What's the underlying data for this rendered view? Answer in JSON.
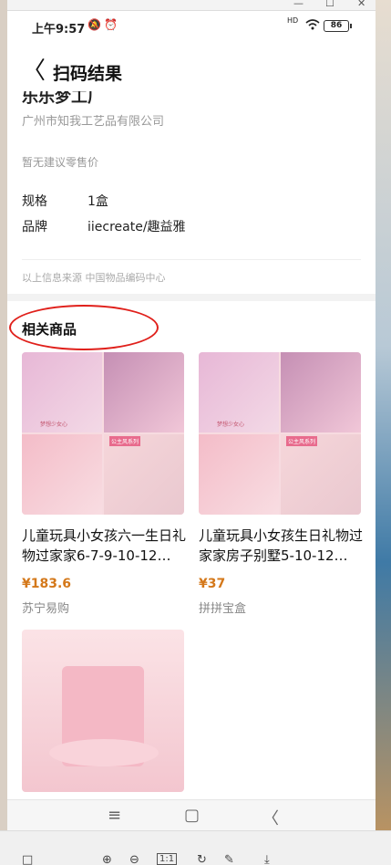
{
  "window": {
    "minimize": "—",
    "maximize": "☐",
    "close": "✕"
  },
  "status_bar": {
    "time": "上午9:57",
    "mute_icon": "🔕",
    "alarm_icon": "⏰",
    "signal": "HD",
    "wifi": "wifi",
    "battery": "86"
  },
  "header": {
    "back": "〈",
    "title": "扫码结果"
  },
  "product": {
    "name_cut": "乐乐梦工厂",
    "company": "广州市知我工艺品有限公司",
    "price_note": "暂无建议零售价",
    "specs": [
      {
        "key": "规格",
        "value": "1盒"
      },
      {
        "key": "品牌",
        "value": "iiecreate/趣益雅"
      }
    ],
    "source": "以上信息来源 中国物品编码中心"
  },
  "related": {
    "title": "相关商品",
    "items": [
      {
        "name": "儿童玩具小女孩六一生日礼物过家家6-7-9-10-12…",
        "price": "¥183.6",
        "store": "苏宁易购",
        "badge1": "梦想少女心",
        "badge2": "公主风系列"
      },
      {
        "name": "儿童玩具小女孩生日礼物过家家房子别墅5-10-12…",
        "price": "¥37",
        "store": "拼拼宝盒",
        "badge1": "梦想少女心",
        "badge2": "公主风系列"
      },
      {
        "name": "",
        "price": "",
        "store": ""
      }
    ]
  },
  "nav": {
    "menu": "≡",
    "home": "▢",
    "back": "〈"
  },
  "toolbar": {
    "tools": [
      "□",
      "⊕",
      "⊖",
      "1:1",
      "↻",
      "✎",
      "⤓"
    ]
  }
}
